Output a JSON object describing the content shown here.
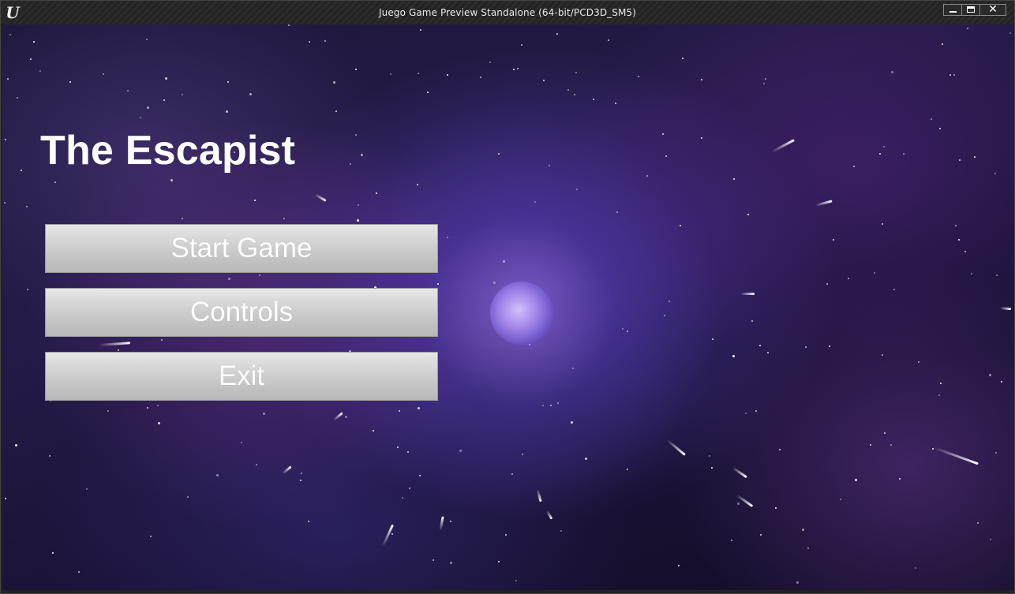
{
  "window": {
    "title": "Juego Game Preview Standalone (64-bit/PCD3D_SM5)",
    "logo_icon": "unreal-engine-logo",
    "controls": {
      "minimize_icon": "minimize-icon",
      "maximize_icon": "maximize-icon",
      "close_icon": "close-icon",
      "close_glyph": "✕"
    }
  },
  "menu": {
    "title": "The Escapist",
    "buttons": [
      {
        "label": "Start Game"
      },
      {
        "label": "Controls"
      },
      {
        "label": "Exit"
      }
    ]
  },
  "background": {
    "description_icon": "space-nebula-background",
    "colors": {
      "deep": "#1b1638",
      "purple": "#6e46dc",
      "core": "#d6c8ff"
    }
  }
}
